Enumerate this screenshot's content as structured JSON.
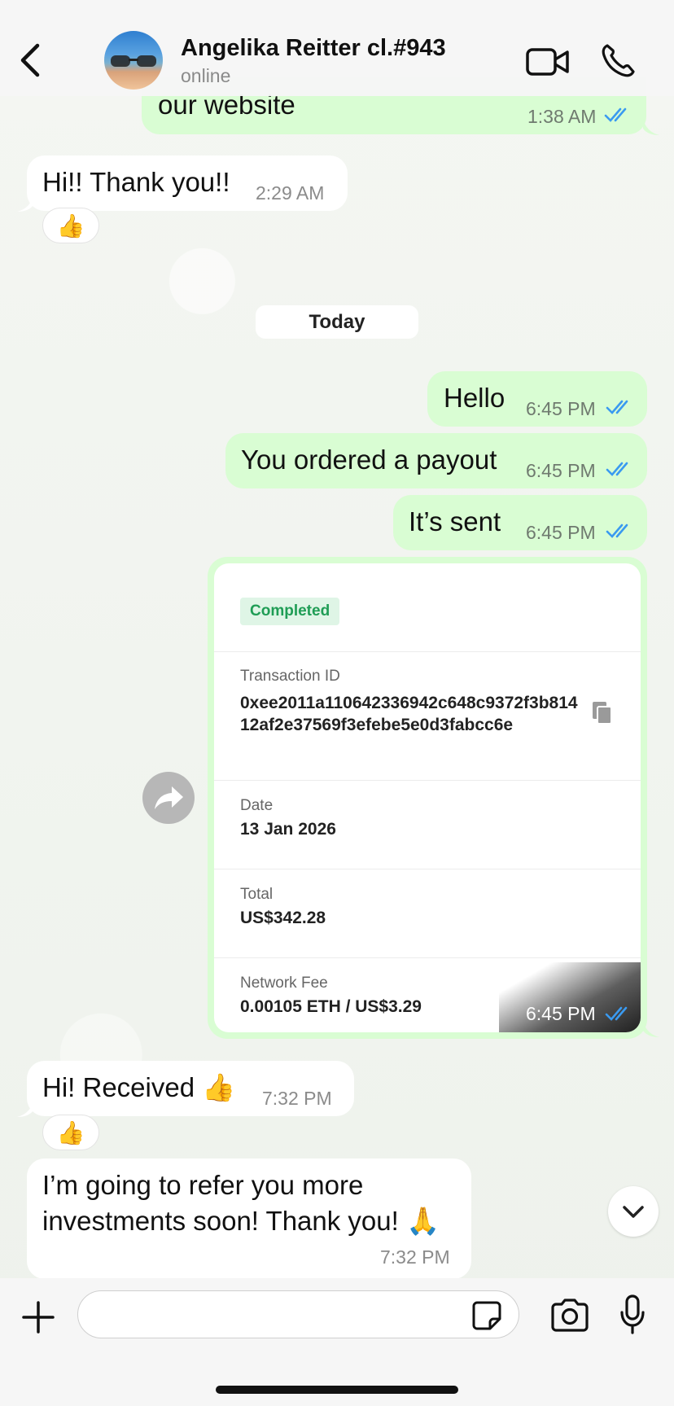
{
  "header": {
    "contact_name": "Angelika Reitter cl.#943",
    "status": "online"
  },
  "messages": {
    "m0": {
      "text": "our website",
      "time": "1:38 AM"
    },
    "m1": {
      "text": "Hi!! Thank you!!",
      "time": "2:29 AM",
      "reaction": "👍"
    },
    "date_separator": "Today",
    "m2": {
      "text": "Hello",
      "time": "6:45 PM"
    },
    "m3": {
      "text": "You ordered a payout",
      "time": "6:45 PM"
    },
    "m4": {
      "text": "It’s sent",
      "time": "6:45 PM"
    },
    "m5": {
      "text": "Hi! Received 👍",
      "time": "7:32 PM",
      "reaction": "👍"
    },
    "m6": {
      "line1": "I’m going to refer you more",
      "line2": "investments soon! Thank you! 🙏",
      "time": "7:32 PM"
    }
  },
  "receipt": {
    "status": "Completed",
    "transaction_id_label": "Transaction ID",
    "transaction_id": "0xee2011a110642336942c648c9372f3b81412af2e37569f3efebe5e0d3fabcc6e",
    "date_label": "Date",
    "date": "13 Jan 2026",
    "total_label": "Total",
    "total": "US$342.28",
    "fee_label": "Network Fee",
    "fee": "0.00105 ETH / US$3.29",
    "time": "6:45 PM"
  },
  "composer": {
    "value": "",
    "placeholder": ""
  },
  "colors": {
    "outgoing_bubble": "#d9fdd3",
    "incoming_bubble": "#ffffff",
    "read_ticks": "#3a9af0",
    "completed_badge": "#1f9d55"
  }
}
